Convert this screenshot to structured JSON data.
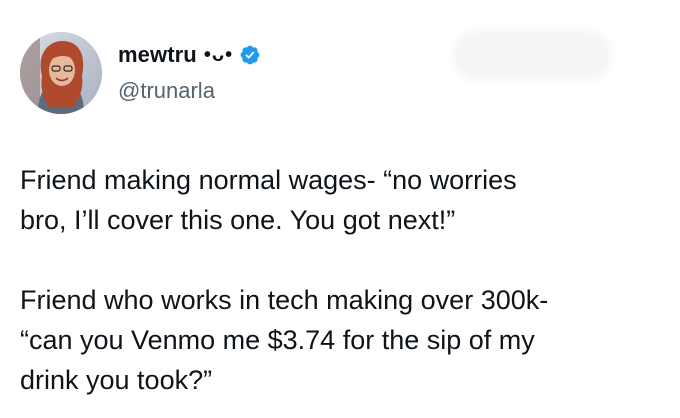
{
  "author": {
    "display_name": "mewtru",
    "name_emoticon": "•ᴗ•",
    "handle": "@trunarla",
    "verified": true,
    "verified_color": "#1d9bf0",
    "avatar_icon": "avatar"
  },
  "tweet": {
    "paragraphs": [
      "Friend making normal wages- “no worries\nbro, I’ll cover this one. You got next!”",
      "Friend who works in tech making over 300k-\n“can you Venmo me $3.74 for the sip of my\ndrink you took?”"
    ]
  },
  "colors": {
    "text": "#0f1419",
    "secondary_text": "#536471",
    "background": "#ffffff"
  }
}
